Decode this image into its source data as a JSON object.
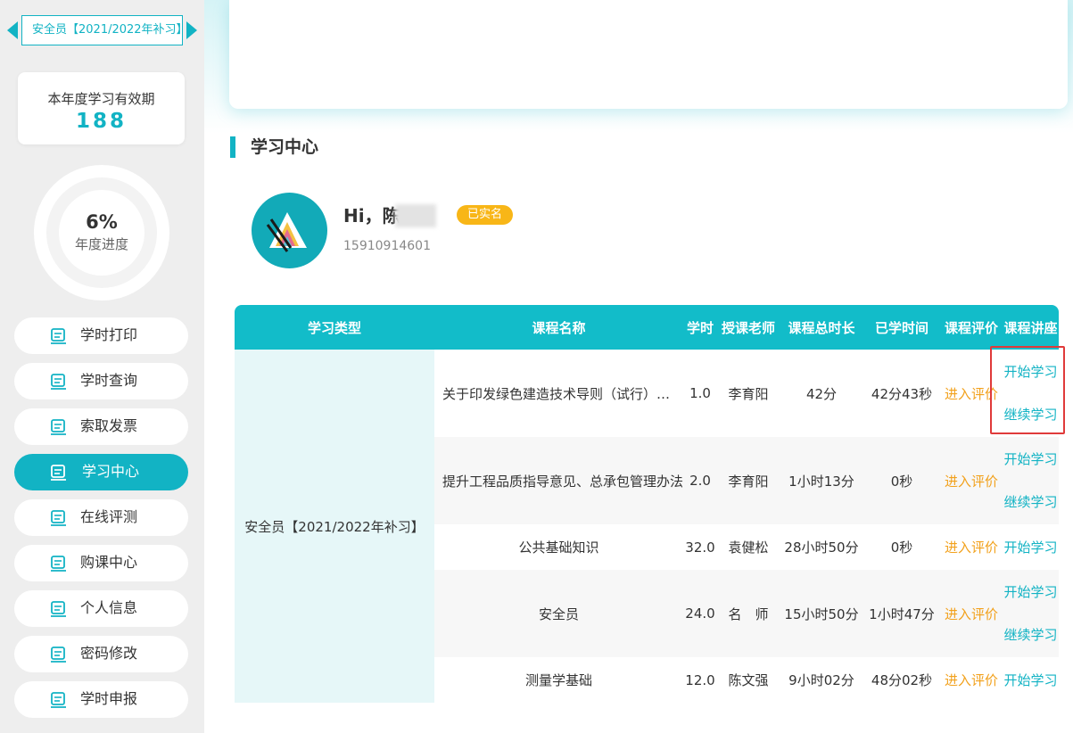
{
  "sidebar": {
    "course_switcher": "安全员【2021/2022年补习】",
    "validity": {
      "label": "本年度学习有效期",
      "value": "188"
    },
    "progress": {
      "value": "6%",
      "label": "年度进度",
      "percent": 6
    },
    "nav": [
      {
        "label": "学时打印",
        "icon": "document-print-icon",
        "active": false
      },
      {
        "label": "学时查询",
        "icon": "document-search-icon",
        "active": false
      },
      {
        "label": "索取发票",
        "icon": "invoice-icon",
        "active": false
      },
      {
        "label": "学习中心",
        "icon": "video-play-icon",
        "active": true
      },
      {
        "label": "在线评测",
        "icon": "online-test-icon",
        "active": false
      },
      {
        "label": "购课中心",
        "icon": "shopping-icon",
        "active": false
      },
      {
        "label": "个人信息",
        "icon": "id-card-icon",
        "active": false
      },
      {
        "label": "密码修改",
        "icon": "password-icon",
        "active": false
      },
      {
        "label": "学时申报",
        "icon": "declare-icon",
        "active": false
      }
    ]
  },
  "main": {
    "section_title": "学习中心",
    "user": {
      "greeting": "Hi，陈",
      "badge": "已实名",
      "phone": "15910914601"
    },
    "table": {
      "headers": [
        "学习类型",
        "课程名称",
        "学时",
        "授课老师",
        "课程总时长",
        "已学时间",
        "课程评价",
        "课程讲座"
      ],
      "type_label": "安全员【2021/2022年补习】",
      "rows": [
        {
          "name": "关于印发绿色建造技术导则（试行）的通知",
          "hours": "1.0",
          "teacher": "李育阳",
          "duration": "42分",
          "studied": "42分43秒",
          "eval": "进入评价",
          "start": "开始学习",
          "continue": "继续学习"
        },
        {
          "name": "提升工程品质指导意见、总承包管理办法",
          "hours": "2.0",
          "teacher": "李育阳",
          "duration": "1小时13分",
          "studied": "0秒",
          "eval": "进入评价",
          "start": "开始学习",
          "continue": "继续学习"
        },
        {
          "name": "公共基础知识",
          "hours": "32.0",
          "teacher": "袁健松",
          "duration": "28小时50分",
          "studied": "0秒",
          "eval": "进入评价",
          "start": "开始学习"
        },
        {
          "name": "安全员",
          "hours": "24.0",
          "teacher": "名　师",
          "duration": "15小时50分",
          "studied": "1小时47分",
          "eval": "进入评价",
          "start": "开始学习",
          "continue": "继续学习"
        },
        {
          "name": "测量学基础",
          "hours": "12.0",
          "teacher": "陈文强",
          "duration": "9小时02分",
          "studied": "48分02秒",
          "eval": "进入评价",
          "start": "开始学习"
        }
      ]
    }
  }
}
